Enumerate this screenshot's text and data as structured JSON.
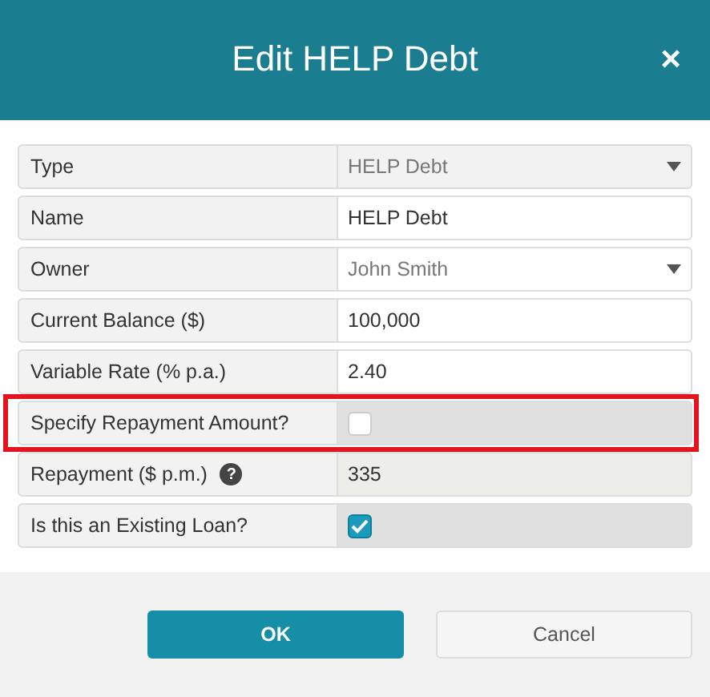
{
  "dialog": {
    "title": "Edit HELP Debt",
    "close": "×"
  },
  "fields": [
    {
      "kind": "select",
      "label": "Type",
      "value": "HELP Debt",
      "disabled": true,
      "highlighted": false
    },
    {
      "kind": "text",
      "label": "Name",
      "value": "HELP Debt",
      "disabled": false,
      "highlighted": false
    },
    {
      "kind": "select",
      "label": "Owner",
      "value": "John Smith",
      "disabled": false,
      "highlighted": false
    },
    {
      "kind": "text",
      "label": "Current Balance ($)",
      "value": "100,000",
      "disabled": false,
      "highlighted": false
    },
    {
      "kind": "text",
      "label": "Variable Rate (% p.a.)",
      "value": "2.40",
      "disabled": false,
      "highlighted": false
    },
    {
      "kind": "checkbox",
      "label": "Specify Repayment Amount?",
      "checked": false,
      "highlighted": true
    },
    {
      "kind": "text",
      "label": "Repayment ($ p.m.)",
      "help": "?",
      "value": "335",
      "disabled": true,
      "highlighted": false
    },
    {
      "kind": "checkbox",
      "label": "Is this an Existing Loan?",
      "checked": true,
      "highlighted": false
    }
  ],
  "buttons": [
    {
      "label": "OK",
      "kind": "primary"
    },
    {
      "label": "Cancel",
      "kind": "secondary"
    }
  ]
}
